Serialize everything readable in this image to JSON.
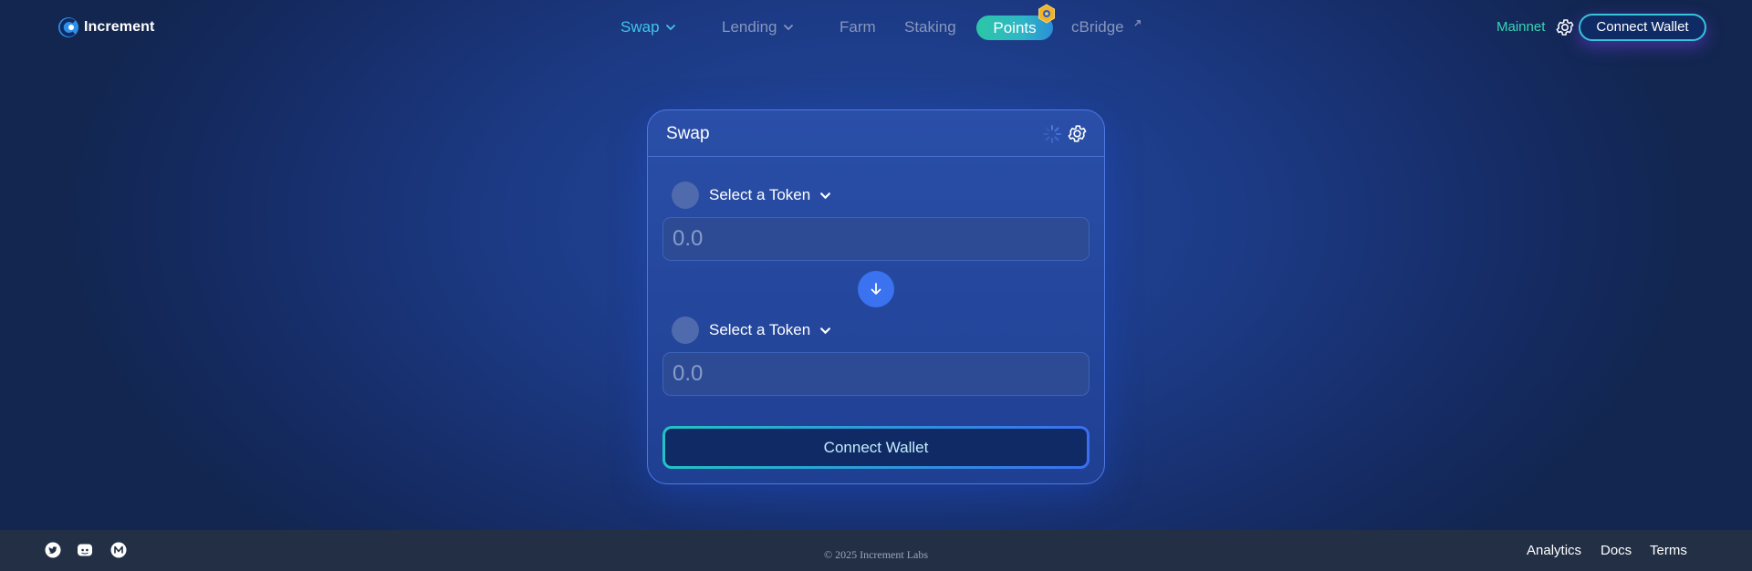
{
  "header": {
    "logo_text": "Increment",
    "nav": {
      "swap": "Swap",
      "lending": "Lending",
      "farm": "Farm",
      "staking": "Staking",
      "points": "Points",
      "cbridge": "cBridge"
    },
    "network": "Mainnet",
    "connect_wallet": "Connect Wallet"
  },
  "swap_card": {
    "title": "Swap",
    "from": {
      "token_label": "Select a Token",
      "placeholder": "0.0"
    },
    "to": {
      "token_label": "Select a Token",
      "placeholder": "0.0"
    },
    "connect_wallet": "Connect Wallet"
  },
  "footer": {
    "copyright": "© 2025 Increment Labs",
    "links": {
      "analytics": "Analytics",
      "docs": "Docs",
      "terms": "Terms"
    }
  },
  "icons": {
    "social": [
      "twitter-icon",
      "discord-icon",
      "medium-icon"
    ],
    "settings": "gear-icon",
    "loading": "spinner-icon",
    "switch": "arrow-down-icon"
  },
  "colors": {
    "accent_cyan": "#3fc5ea",
    "accent_teal": "#38d6b5",
    "primary_blue": "#3a72f0",
    "background": "#1c3a85",
    "footer": "#222f45"
  }
}
